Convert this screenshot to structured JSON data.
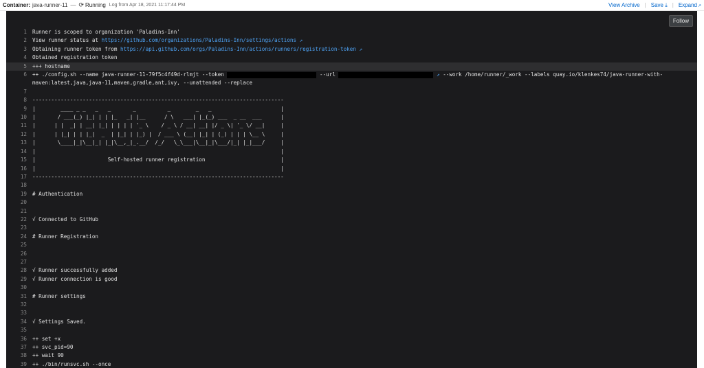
{
  "topbar": {
    "container_label": "Container:",
    "container_name": "java-runner-11",
    "separator": "—",
    "status": "Running",
    "log_meta": "Log from Apr 18, 2021 11:17:44 PM",
    "view_archive": "View Archive",
    "save": "Save",
    "expand": "Expand"
  },
  "follow_label": "Follow",
  "log": {
    "l1": "Runner is scoped to organization 'Paladins-Inn'",
    "l2_pre": "View runner status at ",
    "l2_link": "https://github.com/organizations/Paladins-Inn/settings/actions",
    "l3_pre": "Obtaining runner token from ",
    "l3_link": "https://api.github.com/orgs/Paladins-Inn/actions/runners/registration-token",
    "l4": "Obtained registration token",
    "l5": "+++ hostname",
    "l6_a": "++ ./config.sh --name java-runner-11-79f5c4f49d-rlmjt --token ",
    "l6_b": "--url ",
    "l6_c": "--work /home/runner/_work --labels quay.io/klenkes74/java-runner-with-",
    "l6_cont": "maven:latest,java,java-11,maven,gradle,ant,ivy, --unattended --replace",
    "rule": "--------------------------------------------------------------------------------",
    "a1": "|        ____ _ _   _   _       _          _        _   _                      |",
    "a2": "|       / ___(_) |_| | | |_   _| |__      / \\   ___| |_(_) ___  _ __  ___      |",
    "a3": "|      | |  _| | __| |_| | | | | '_ \\    / _ \\ / __| __| |/ _ \\| '_ \\/ __|     |",
    "a4": "|      | |_| | | |_|  _  | |_| | |_) |  / ___ \\ (__| |_| | (_) | | | \\__ \\     |",
    "a5": "|       \\____|_|\\__|_| |_|\\__,_|_.__/  /_/   \\_\\___|\\__|_|\\___/|_| |_|___/     |",
    "a6": "|                                                                              |",
    "a7": "|                       Self-hosted runner registration                        |",
    "a8": "|                                                                              |",
    "l19": "# Authentication",
    "l22": "√ Connected to GitHub",
    "l24": "# Runner Registration",
    "l28": "√ Runner successfully added",
    "l29": "√ Runner connection is good",
    "l31": "# Runner settings",
    "l34": "√ Settings Saved.",
    "l36": "++ set +x",
    "l37": "++ svc_pid=90",
    "l38": "++ wait 90",
    "l39": "++ ./bin/runsvc.sh --once"
  },
  "line_numbers": [
    "1",
    "2",
    "3",
    "4",
    "5",
    "6",
    "",
    "7",
    "8",
    "9",
    "10",
    "11",
    "12",
    "13",
    "14",
    "15",
    "16",
    "17",
    "18",
    "19",
    "20",
    "21",
    "22",
    "23",
    "24",
    "25",
    "26",
    "27",
    "28",
    "29",
    "30",
    "31",
    "32",
    "33",
    "34",
    "35",
    "36",
    "37",
    "38",
    "39"
  ],
  "colors": {
    "log_bg": "#1b1b1d",
    "link": "#4ea3f5",
    "top_link": "#0066cc"
  }
}
